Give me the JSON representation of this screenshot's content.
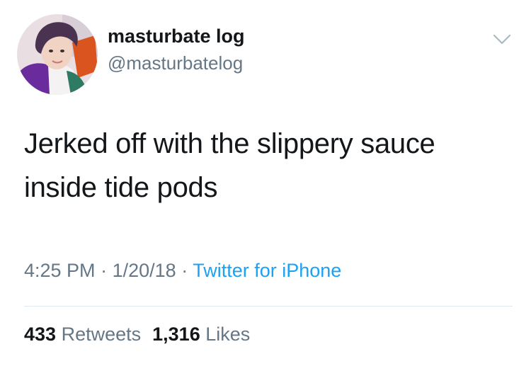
{
  "user": {
    "display_name": "masturbate log",
    "handle": "@masturbatelog"
  },
  "tweet": {
    "text_line1": "Jerked off with the slippery sauce",
    "text_line2": "inside tide pods"
  },
  "meta": {
    "time": "4:25 PM",
    "separator": "·",
    "date": "1/20/18",
    "source": "Twitter for iPhone"
  },
  "stats": {
    "retweets_count": "433",
    "retweets_label": "Retweets",
    "likes_count": "1,316",
    "likes_label": "Likes"
  },
  "icons": {
    "avatar": "profile-photo",
    "caret": "chevron-down-icon"
  },
  "colors": {
    "primary_text": "#14171a",
    "secondary_text": "#657786",
    "link": "#1da1f2",
    "divider": "#e1e8ed"
  }
}
